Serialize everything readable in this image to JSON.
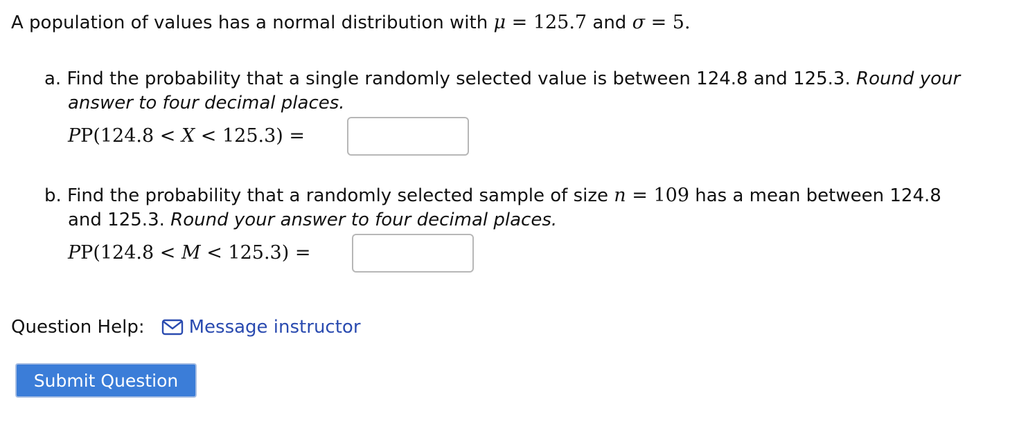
{
  "intro": {
    "text_before_mu": "A population of values has a normal distribution with ",
    "mu_symbol": "μ",
    "mu_eq": " = 125.7",
    "and_text": " and ",
    "sigma_symbol": "σ",
    "sigma_eq": " = 5",
    "end": "."
  },
  "part_a": {
    "line1_text": "a. Find the probability that a single randomly selected value is between 124.8 and 125.3. ",
    "line1_italic": "Round your",
    "line2_italic": "answer to four decimal places.",
    "prob_prefix": "P(124.8 < ",
    "prob_var": "X",
    "prob_suffix": " < 125.3)  =",
    "answer_value": "",
    "answer_placeholder": ""
  },
  "part_b": {
    "line1_text": "b. Find the probability that a randomly selected sample of size ",
    "n_symbol": "n",
    "n_eq": " = 109",
    "line1_rest": " has a mean between 124.8",
    "line2_text": "and 125.3. ",
    "line2_italic": "Round your answer to four decimal places.",
    "prob_prefix": "P(124.8 < ",
    "prob_var": "M",
    "prob_suffix": " < 125.3)  =",
    "answer_value": "",
    "answer_placeholder": ""
  },
  "help": {
    "label": "Question Help:",
    "icon": "mail-icon",
    "link_text": "Message instructor",
    "link_color": "#2a4bb0"
  },
  "submit": {
    "label": "Submit Question",
    "color": "#3b7dd8"
  }
}
